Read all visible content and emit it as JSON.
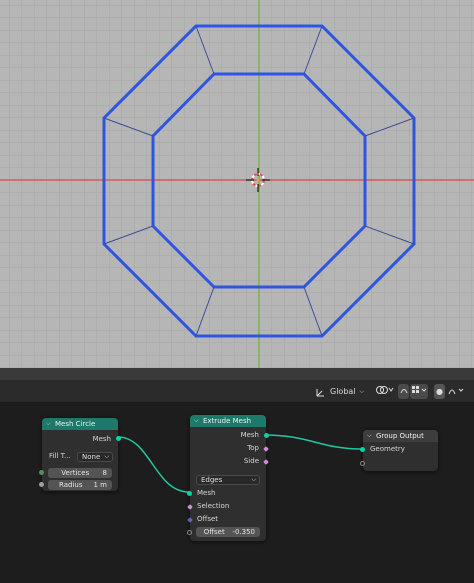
{
  "header": {
    "orientation_label": "Global",
    "orientation_icon": "transform-orientation-icon",
    "snap_icon": "snap-icon",
    "proportional_icon": "proportional-edit-icon",
    "overlay_icon": "overlay-icon",
    "gizmo_icon": "gizmo-icon",
    "falloff_icon": "falloff-curve-icon"
  },
  "nodes": {
    "mesh_circle": {
      "title": "Mesh Circle",
      "output_mesh": "Mesh",
      "fill_label": "Fill T...",
      "fill_value": "None",
      "vertices_label": "Vertices",
      "vertices_value": "8",
      "radius_label": "Radius",
      "radius_value": "1 m"
    },
    "extrude_mesh": {
      "title": "Extrude Mesh",
      "output_mesh": "Mesh",
      "output_top": "Top",
      "output_side": "Side",
      "mode_value": "Edges",
      "input_mesh": "Mesh",
      "input_selection": "Selection",
      "input_offset": "Offset",
      "offset_scale_label": "Offset",
      "offset_scale_value": "-0.350"
    },
    "group_output": {
      "title": "Group Output",
      "input_geometry": "Geometry"
    }
  },
  "colors": {
    "viewport_bg": "#b6b6b6",
    "mesh_edge": "#2f55e0",
    "x_axis": "#d64a4a",
    "y_axis": "#6bb33a",
    "node_header_geometry": "#1d7a6a",
    "geometry_socket": "#00d6a3",
    "wire": "#1fc9a2"
  }
}
